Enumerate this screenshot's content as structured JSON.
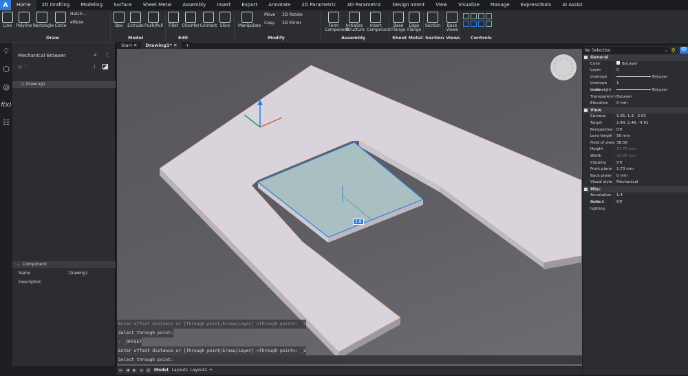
{
  "app": {
    "logo": "A"
  },
  "menu_tabs": [
    "Home",
    "2D Drafting",
    "Modeling",
    "Surface",
    "Sheet Metal",
    "Assembly",
    "Insert",
    "Export",
    "Annotate",
    "2D Parametric",
    "3D Parametric",
    "Design Intent",
    "View",
    "Visualize",
    "Manage",
    "ExpressTools",
    "AI Assist"
  ],
  "ribbon": {
    "tools": [
      "Line",
      "Polyline",
      "Rectangle",
      "Circle",
      "Box",
      "Extrude",
      "Push/Pull",
      "Fillet",
      "Chamfer",
      "Connect",
      "Slice",
      "Manipulate",
      "Form Component",
      "Initialize Structure",
      "Insert Component",
      "Base Flange",
      "Edge Flange",
      "Section",
      "Base Views"
    ],
    "small": [
      "Hatch...",
      "ellipse",
      "Move",
      "Copy",
      "3D Rotate",
      "3D Mirror"
    ],
    "groups": [
      "Draw",
      "Model",
      "Edit",
      "Modify",
      "Assembly",
      "Sheet Metal",
      "Section",
      "Views",
      "Controls"
    ]
  },
  "doc_tabs": [
    "Start",
    "Drawing1*"
  ],
  "left_panel": {
    "title": "Mechanical Browser",
    "tree": [
      "Drawing1"
    ],
    "component_header": "Component",
    "fields": [
      {
        "k": "Name",
        "v": "Drawing1"
      },
      {
        "k": "Description",
        "v": ""
      }
    ]
  },
  "viewport": {
    "dimension_value": "2.8"
  },
  "command_lines": [
    "Enter offset distance or [Through point/Erase/Layer] <Through point>: _S",
    "Select through point:",
    ": _OFFSET",
    "Enter offset distance or [Through point/Erase/Layer] <Through point>: _S",
    "Select through point:"
  ],
  "layout_tabs": [
    "Model",
    "Layout1",
    "Layout2",
    "+"
  ],
  "properties": {
    "selection": "No Selection",
    "sections": [
      {
        "name": "General",
        "rows": [
          {
            "k": "Color",
            "v": "ByLayer"
          },
          {
            "k": "Layer",
            "v": "0"
          },
          {
            "k": "Linetype",
            "v": "ByLayer"
          },
          {
            "k": "Linetype scale",
            "v": "1"
          },
          {
            "k": "Lineweight",
            "v": "ByLayer"
          },
          {
            "k": "Transparency",
            "v": "ByLayer"
          },
          {
            "k": "Elevation",
            "v": "0 mm"
          }
        ]
      },
      {
        "name": "View",
        "rows": [
          {
            "k": "Camera",
            "v": "1.65, 1.3, -3.93"
          },
          {
            "k": "Target",
            "v": "2.49, 2.46, -4.91"
          },
          {
            "k": "Perspective",
            "v": "Off"
          },
          {
            "k": "Lens length",
            "v": "50 mm"
          },
          {
            "k": "Field of view",
            "v": "38.58"
          },
          {
            "k": "Height",
            "v": "17.75 mm"
          },
          {
            "k": "Width",
            "v": "25.97 mm"
          },
          {
            "k": "Clipping",
            "v": "Off"
          },
          {
            "k": "Front plane",
            "v": "1.73 mm"
          },
          {
            "k": "Back plane",
            "v": "0 mm"
          },
          {
            "k": "Visual style",
            "v": "Mechanical"
          }
        ]
      },
      {
        "name": "Misc",
        "rows": [
          {
            "k": "Annotation scale",
            "v": "1:4"
          },
          {
            "k": "Default lighting",
            "v": "Off"
          }
        ]
      }
    ]
  }
}
